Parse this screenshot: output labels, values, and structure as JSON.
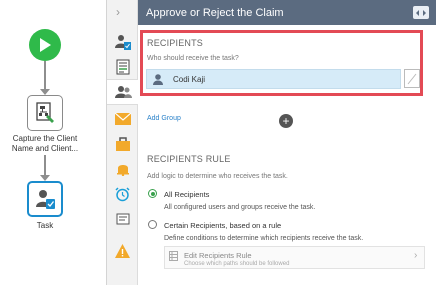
{
  "header": {
    "title": "Approve or Reject the Claim"
  },
  "workflow": {
    "nodes": [
      {
        "label": "Capture the Client Name and Client..."
      },
      {
        "label": "Task"
      }
    ]
  },
  "recipients": {
    "heading": "RECIPIENTS",
    "question": "Who should receive the task?",
    "selected": "Codi Kaji",
    "add_group": "Add Group"
  },
  "rule": {
    "heading": "RECIPIENTS RULE",
    "description": "Add logic to determine who receives the task.",
    "options": [
      {
        "label": "All Recipients",
        "desc": "All configured users and groups receive the task.",
        "selected": true
      },
      {
        "label": "Certain Recipients, based on a rule",
        "desc": "Define conditions to determine which recipients receive the task.",
        "selected": false
      }
    ],
    "edit_title": "Edit Recipients Rule",
    "edit_sub": "Choose which paths should be followed"
  },
  "colors": {
    "start": "#2fba4a",
    "header": "#5b6b80",
    "highlight": "#e34a55",
    "link": "#2b82c9"
  },
  "strip_icons": [
    "user-check-icon",
    "form-icon",
    "users-icon",
    "mail-icon",
    "briefcase-icon",
    "bell-icon",
    "alarm-clock-icon",
    "notes-icon",
    "warning-icon"
  ]
}
